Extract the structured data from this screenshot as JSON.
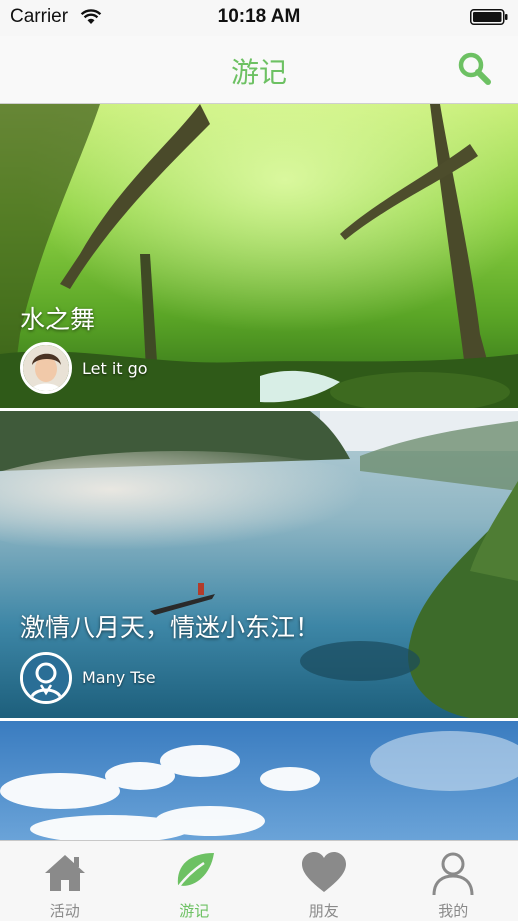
{
  "status_bar": {
    "carrier": "Carrier",
    "time": "10:18 AM"
  },
  "nav": {
    "title": "游记"
  },
  "feed": {
    "cards": [
      {
        "title": "水之舞",
        "author": "Let it go"
      },
      {
        "title": "激情八月天，情迷小东江！",
        "author": "Many Tse"
      },
      {
        "title": "",
        "author": ""
      }
    ]
  },
  "tabs": [
    {
      "label": "活动",
      "icon": "home-icon",
      "active": false
    },
    {
      "label": "游记",
      "icon": "leaf-icon",
      "active": true
    },
    {
      "label": "朋友",
      "icon": "heart-icon",
      "active": false
    },
    {
      "label": "我的",
      "icon": "person-icon",
      "active": false
    }
  ],
  "colors": {
    "accent": "#6dc163",
    "inactive": "#8a8a8a"
  }
}
